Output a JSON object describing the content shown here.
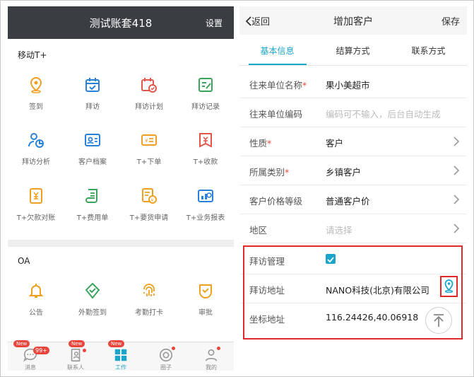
{
  "left": {
    "header": {
      "title": "测试账套418",
      "settings_label": "设置"
    },
    "section_mobile": {
      "title": "移动T+",
      "items": [
        {
          "label": "签到",
          "icon": "location-pin-icon"
        },
        {
          "label": "拜访",
          "icon": "calendar-check-icon"
        },
        {
          "label": "拜访计划",
          "icon": "calendar-plan-icon"
        },
        {
          "label": "拜访记录",
          "icon": "edit-note-icon"
        },
        {
          "label": "拜访分析",
          "icon": "person-chart-icon"
        },
        {
          "label": "客户档案",
          "icon": "id-card-icon"
        },
        {
          "label": "T+下单",
          "icon": "order-icon"
        },
        {
          "label": "T+收款",
          "icon": "receipt-icon"
        },
        {
          "label": "T+欠款对账",
          "icon": "yuan-doc-icon"
        },
        {
          "label": "T+费用单",
          "icon": "scroll-icon"
        },
        {
          "label": "T+要货申请",
          "icon": "request-icon"
        },
        {
          "label": "T+业务报表",
          "icon": "report-icon"
        }
      ]
    },
    "section_oa": {
      "title": "OA",
      "items": [
        {
          "label": "公告",
          "icon": "bell-icon"
        },
        {
          "label": "外勤签到",
          "icon": "shield-check-icon"
        },
        {
          "label": "考勤打卡",
          "icon": "fingerprint-icon"
        },
        {
          "label": "审批",
          "icon": "approval-icon"
        }
      ]
    },
    "tabbar": {
      "badge_new": "New",
      "badge_count": "99+",
      "items": [
        {
          "label": "消息",
          "icon": "chat-icon"
        },
        {
          "label": "联系人",
          "icon": "contacts-icon"
        },
        {
          "label": "工作",
          "icon": "grid-apps-icon"
        },
        {
          "label": "圈子",
          "icon": "circle-icon"
        },
        {
          "label": "我的",
          "icon": "profile-icon"
        }
      ]
    }
  },
  "right": {
    "header": {
      "back_label": "返回",
      "title": "增加客户",
      "save_label": "保存"
    },
    "tabs": [
      {
        "label": "基本信息"
      },
      {
        "label": "结算方式"
      },
      {
        "label": "联系方式"
      }
    ],
    "form": {
      "name": {
        "label": "往来单位名称",
        "required": "*",
        "value": "果小美超市"
      },
      "code": {
        "label": "往来单位编码",
        "placeholder": "编码可不输入，后台自动生成"
      },
      "nature": {
        "label": "性质",
        "required": "*",
        "value": "客户"
      },
      "category": {
        "label": "所属类别",
        "required": "*",
        "value": "乡镇客户"
      },
      "price_level": {
        "label": "客户价格等级",
        "value": "普通客户价"
      },
      "region": {
        "label": "地区",
        "placeholder": "请选择"
      },
      "visit_mgmt": {
        "label": "拜访管理"
      },
      "visit_address": {
        "label": "拜访地址",
        "value": "NANO科技(北京)有限公司"
      },
      "coordinates": {
        "label": "坐标地址",
        "value": "116.24426,40.06918"
      }
    }
  },
  "colors": {
    "accent": "#1ba6c9",
    "header_dark": "#3a3d42",
    "icon_orange": "#f0a020",
    "highlight_red": "#e02a2a"
  }
}
